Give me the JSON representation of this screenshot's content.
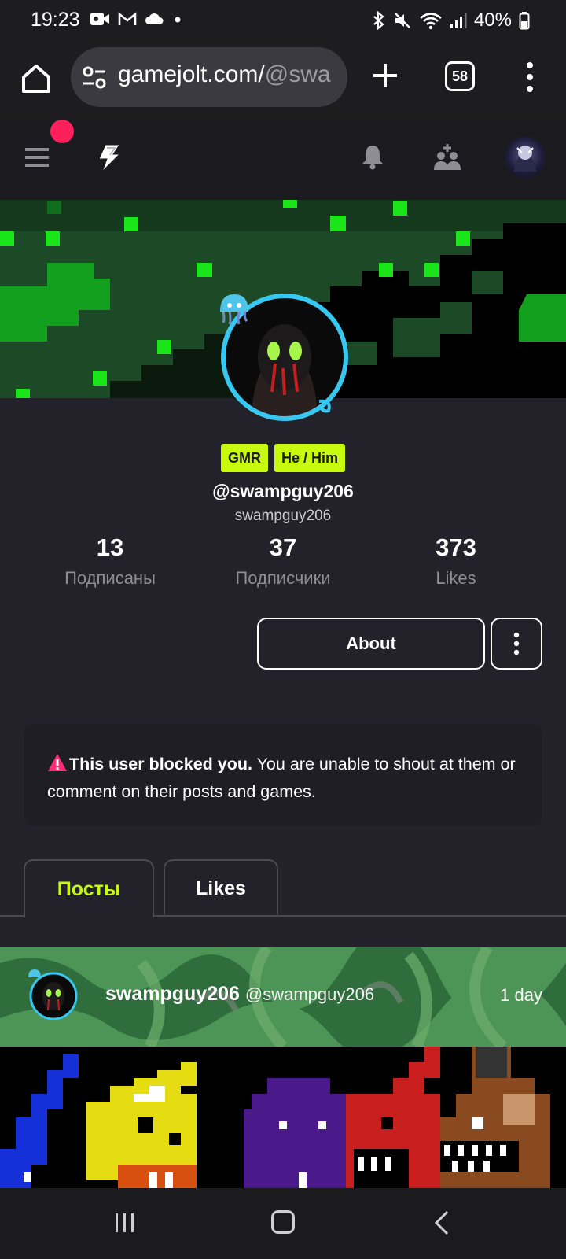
{
  "status_bar": {
    "time": "19:23",
    "battery": "40%",
    "left_icons": [
      "video-icon",
      "gmail-icon",
      "cloud-icon",
      "dot-icon"
    ],
    "right_icons": [
      "bluetooth-icon",
      "mute-icon",
      "wifi-icon",
      "signal-icon",
      "battery-icon"
    ]
  },
  "browser": {
    "url_host": "gamejolt.com/",
    "url_path": "@swa",
    "tab_count": "58"
  },
  "profile": {
    "badges": [
      "GMR",
      "He / Him"
    ],
    "handle": "@swampguy206",
    "username": "swampguy206",
    "stats": [
      {
        "value": "13",
        "label": "Подписаны"
      },
      {
        "value": "37",
        "label": "Подписчики"
      },
      {
        "value": "373",
        "label": "Likes"
      }
    ],
    "about_label": "About"
  },
  "alert": {
    "bold": "This user blocked you.",
    "text": " You are unable to shout at them or comment on their posts and games."
  },
  "tabs": [
    {
      "label": "Посты",
      "active": true
    },
    {
      "label": "Likes",
      "active": false
    }
  ],
  "post": {
    "author": "swampguy206",
    "author_handle": "@swampguy206",
    "time": "1 day"
  },
  "colors": {
    "accent": "#c8fa0f",
    "notification": "#ff1f5a",
    "background": "#232129",
    "avatar_ring": "#36c8f0"
  }
}
